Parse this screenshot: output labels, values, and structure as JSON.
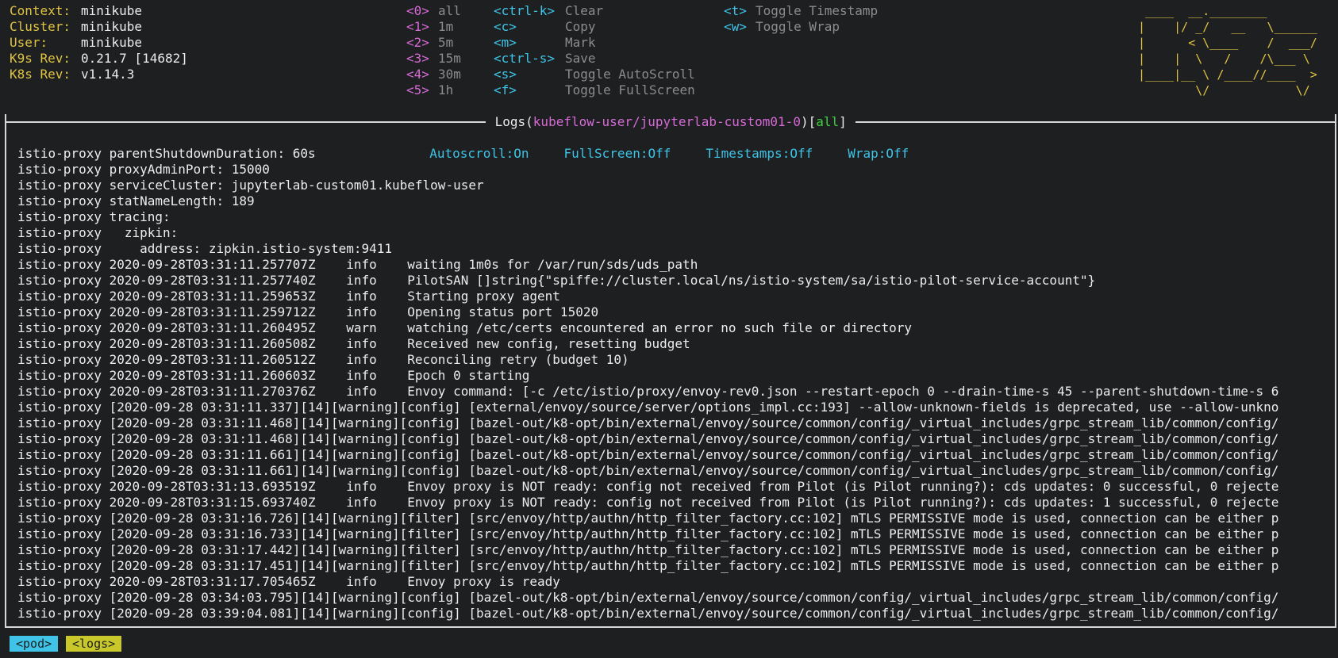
{
  "header": {
    "info": [
      {
        "label": "Context:",
        "value": "minikube"
      },
      {
        "label": "Cluster:",
        "value": "minikube"
      },
      {
        "label": "User:",
        "value": "minikube"
      },
      {
        "label": "K9s Rev:",
        "value": "0.21.7 [14682]"
      },
      {
        "label": "K8s Rev:",
        "value": "v1.14.3"
      }
    ],
    "filters": [
      {
        "key": "<0>",
        "label": "all"
      },
      {
        "key": "<1>",
        "label": "1m"
      },
      {
        "key": "<2>",
        "label": "5m"
      },
      {
        "key": "<3>",
        "label": "15m"
      },
      {
        "key": "<4>",
        "label": "30m"
      },
      {
        "key": "<5>",
        "label": "1h"
      }
    ],
    "actions": [
      {
        "key": "<ctrl-k>",
        "label": "Clear"
      },
      {
        "key": "<c>",
        "label": "Copy"
      },
      {
        "key": "<m>",
        "label": "Mark"
      },
      {
        "key": "<ctrl-s>",
        "label": "Save"
      },
      {
        "key": "<s>",
        "label": "Toggle AutoScroll"
      },
      {
        "key": "<f>",
        "label": "Toggle FullScreen"
      }
    ],
    "toggles": [
      {
        "key": "<t>",
        "label": "Toggle Timestamp"
      },
      {
        "key": "<w>",
        "label": "Toggle Wrap"
      }
    ],
    "logo_lines": [
      " ____  __.________       ",
      "|    |/ _/   __   \\______",
      "|      < \\____    /  ___/",
      "|    |  \\   /    /\\___ \\ ",
      "|____|__ \\ /____//____  >",
      "        \\/            \\/ "
    ]
  },
  "logs_view": {
    "title_prefix": " Logs(",
    "title_resource": "kubeflow-user/jupyterlab-custom01-0",
    "title_mid": ")[",
    "title_filter": "all",
    "title_suffix": "] ",
    "status": [
      "Autoscroll:On",
      "FullScreen:Off",
      "Timestamps:Off",
      "Wrap:Off"
    ],
    "lines": [
      "istio-proxy parentShutdownDuration: 60s",
      "istio-proxy proxyAdminPort: 15000",
      "istio-proxy serviceCluster: jupyterlab-custom01.kubeflow-user",
      "istio-proxy statNameLength: 189",
      "istio-proxy tracing:",
      "istio-proxy   zipkin:",
      "istio-proxy     address: zipkin.istio-system:9411",
      "istio-proxy 2020-09-28T03:31:11.257707Z    info    waiting 1m0s for /var/run/sds/uds_path",
      "istio-proxy 2020-09-28T03:31:11.257740Z    info    PilotSAN []string{\"spiffe://cluster.local/ns/istio-system/sa/istio-pilot-service-account\"}",
      "istio-proxy 2020-09-28T03:31:11.259653Z    info    Starting proxy agent",
      "istio-proxy 2020-09-28T03:31:11.259712Z    info    Opening status port 15020",
      "istio-proxy 2020-09-28T03:31:11.260495Z    warn    watching /etc/certs encountered an error no such file or directory",
      "istio-proxy 2020-09-28T03:31:11.260508Z    info    Received new config, resetting budget",
      "istio-proxy 2020-09-28T03:31:11.260512Z    info    Reconciling retry (budget 10)",
      "istio-proxy 2020-09-28T03:31:11.260603Z    info    Epoch 0 starting",
      "istio-proxy 2020-09-28T03:31:11.270376Z    info    Envoy command: [-c /etc/istio/proxy/envoy-rev0.json --restart-epoch 0 --drain-time-s 45 --parent-shutdown-time-s 6",
      "istio-proxy [2020-09-28 03:31:11.337][14][warning][config] [external/envoy/source/server/options_impl.cc:193] --allow-unknown-fields is deprecated, use --allow-unkno",
      "istio-proxy [2020-09-28 03:31:11.468][14][warning][config] [bazel-out/k8-opt/bin/external/envoy/source/common/config/_virtual_includes/grpc_stream_lib/common/config/",
      "istio-proxy [2020-09-28 03:31:11.468][14][warning][config] [bazel-out/k8-opt/bin/external/envoy/source/common/config/_virtual_includes/grpc_stream_lib/common/config/",
      "istio-proxy [2020-09-28 03:31:11.661][14][warning][config] [bazel-out/k8-opt/bin/external/envoy/source/common/config/_virtual_includes/grpc_stream_lib/common/config/",
      "istio-proxy [2020-09-28 03:31:11.661][14][warning][config] [bazel-out/k8-opt/bin/external/envoy/source/common/config/_virtual_includes/grpc_stream_lib/common/config/",
      "istio-proxy 2020-09-28T03:31:13.693519Z    info    Envoy proxy is NOT ready: config not received from Pilot (is Pilot running?): cds updates: 0 successful, 0 rejecte",
      "istio-proxy 2020-09-28T03:31:15.693740Z    info    Envoy proxy is NOT ready: config not received from Pilot (is Pilot running?): cds updates: 1 successful, 0 rejecte",
      "istio-proxy [2020-09-28 03:31:16.726][14][warning][filter] [src/envoy/http/authn/http_filter_factory.cc:102] mTLS PERMISSIVE mode is used, connection can be either p",
      "istio-proxy [2020-09-28 03:31:16.733][14][warning][filter] [src/envoy/http/authn/http_filter_factory.cc:102] mTLS PERMISSIVE mode is used, connection can be either p",
      "istio-proxy [2020-09-28 03:31:17.442][14][warning][filter] [src/envoy/http/authn/http_filter_factory.cc:102] mTLS PERMISSIVE mode is used, connection can be either p",
      "istio-proxy [2020-09-28 03:31:17.451][14][warning][filter] [src/envoy/http/authn/http_filter_factory.cc:102] mTLS PERMISSIVE mode is used, connection can be either p",
      "istio-proxy 2020-09-28T03:31:17.705465Z    info    Envoy proxy is ready",
      "istio-proxy [2020-09-28 03:34:03.795][14][warning][config] [bazel-out/k8-opt/bin/external/envoy/source/common/config/_virtual_includes/grpc_stream_lib/common/config/",
      "istio-proxy [2020-09-28 03:39:04.081][14][warning][config] [bazel-out/k8-opt/bin/external/envoy/source/common/config/_virtual_includes/grpc_stream_lib/common/config/"
    ]
  },
  "breadcrumbs": [
    {
      "label": "<pod>",
      "color": "#3fc3e6"
    },
    {
      "label": "<logs>",
      "color": "#c8c82a"
    }
  ]
}
